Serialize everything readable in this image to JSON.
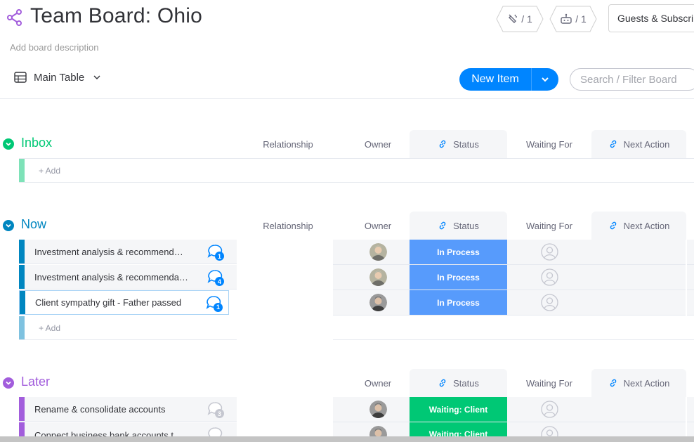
{
  "board": {
    "title": "Team Board: Ohio",
    "description": "Add board description"
  },
  "toolbar": {
    "activity_count": "/ 1",
    "automation_count": "/ 1",
    "guests_label": "Guests & Subscribers",
    "view_label": "Main Table",
    "new_item_label": "New Item",
    "search_placeholder": "Search / Filter Board"
  },
  "colors": {
    "inbox": "#00c875",
    "now": "#0086c0",
    "later": "#a25ddc",
    "in_process": "#579bfc",
    "waiting_client": "#00c875",
    "accent": "#0085ff"
  },
  "columns": {
    "relationship": "Relationship",
    "owner": "Owner",
    "status": "Status",
    "waiting_for": "Waiting For",
    "next_action": "Next Action"
  },
  "groups": [
    {
      "name": "Inbox",
      "add_label": "+ Add",
      "items": []
    },
    {
      "name": "Now",
      "add_label": "+ Add",
      "items": [
        {
          "name": "Investment analysis & recommend…",
          "comments": "1",
          "status": "In Process"
        },
        {
          "name": "Investment analysis & recommenda…",
          "comments": "4",
          "status": "In Process"
        },
        {
          "name": "Client sympathy gift - Father passed",
          "comments": "1",
          "status": "In Process"
        }
      ]
    },
    {
      "name": "Later",
      "items": [
        {
          "name": "Rename & consolidate accounts",
          "comments": "3",
          "status": "Waiting: Client"
        },
        {
          "name": "Connect business bank accounts t",
          "comments": "",
          "status": "Waiting: Client"
        }
      ]
    }
  ]
}
